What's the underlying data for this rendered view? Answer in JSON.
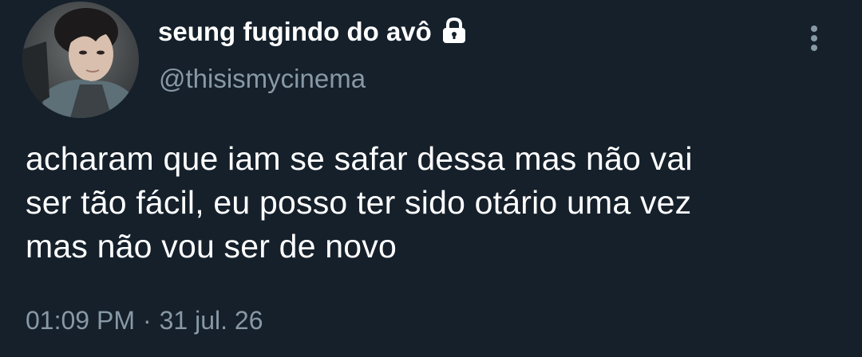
{
  "author": {
    "display_name": "seung fugindo do avô",
    "handle": "@thisismycinema",
    "protected_icon": "lock-icon",
    "avatar_icon": "profile-photo"
  },
  "menu": {
    "icon": "more-vertical-icon"
  },
  "tweet": {
    "lines": [
      "acharam que iam se safar dessa mas não vai",
      "ser tão fácil, eu posso ter sido otário uma vez",
      "mas não vou ser de novo"
    ]
  },
  "meta": {
    "time": "01:09 PM",
    "separator": "·",
    "date": "31 jul. 26"
  },
  "colors": {
    "background": "#15202b",
    "primary_text": "#ffffff",
    "secondary_text": "#8899a6"
  }
}
